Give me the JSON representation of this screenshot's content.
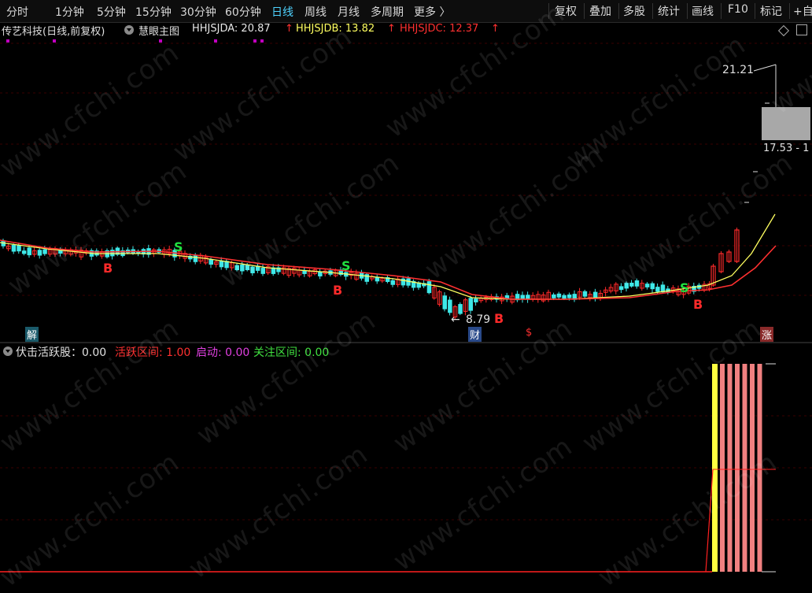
{
  "toolbar": {
    "tabs": [
      "分时",
      "1分钟",
      "5分钟",
      "15分钟",
      "30分钟",
      "60分钟",
      "日线",
      "周线",
      "月线",
      "多周期",
      "更多 〉"
    ],
    "active_tab": "日线",
    "right_buttons": [
      "复权",
      "叠加",
      "多股",
      "统计",
      "画线",
      "F10",
      "标记",
      "+自"
    ]
  },
  "main_chart": {
    "title": "传艺科技(日线,前复权)",
    "indicator_name": "慧眼主图",
    "lines": [
      {
        "label": "HHJSJDA: 20.87",
        "color": "#e8e8e8",
        "arrow": "↑"
      },
      {
        "label": "HHJSJDB: 13.82",
        "color": "#ffff60",
        "arrow": "↑"
      },
      {
        "label": "HHJSJDC: 12.37",
        "color": "#ff3030",
        "arrow": "↑"
      }
    ],
    "price_high_label": "21.21",
    "price_low_label": "8.79",
    "range_label": "17.53 - 1",
    "signal_labels": {
      "buy": "B",
      "sell": "S"
    },
    "event_badges": [
      "解",
      "财",
      "$",
      "涨"
    ]
  },
  "sub_chart": {
    "title": "伏击活跃股：0.00",
    "items": [
      {
        "label": "活跃区间: 1.00",
        "color": "#ff3030"
      },
      {
        "label": "启动: 0.00",
        "color": "#e040e0"
      },
      {
        "label": "关注区间: 0.00",
        "color": "#40e040"
      }
    ]
  },
  "watermark": "www.cfchi.com",
  "colors": {
    "up": "#ff2a2a",
    "down": "#3ee8e8",
    "ma_short": "#ffff60",
    "ma_long": "#ff3030",
    "accent": "#4fd3ff"
  }
}
